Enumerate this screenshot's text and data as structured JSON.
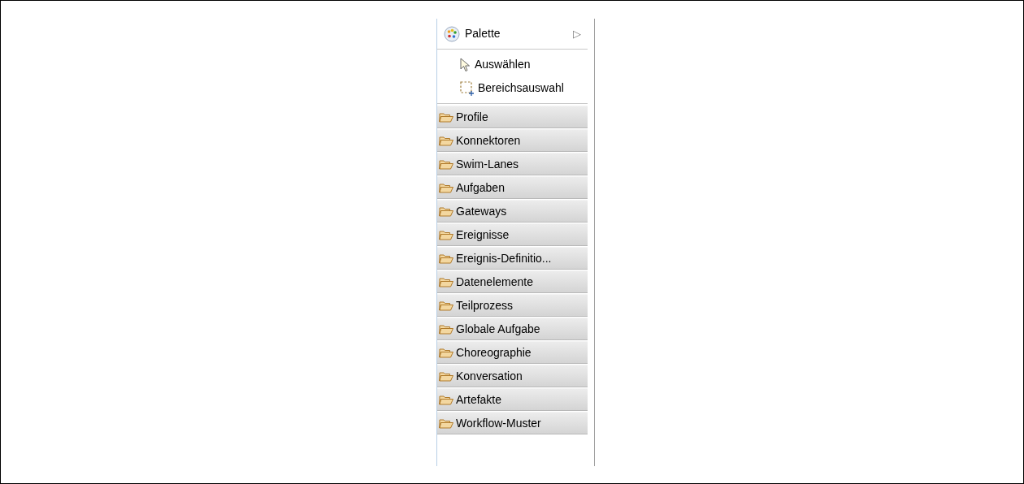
{
  "palette": {
    "title": "Palette",
    "expand_glyph": "▷",
    "tools": [
      {
        "kind": "select",
        "label": "Auswählen"
      },
      {
        "kind": "marquee",
        "label": "Bereichsauswahl"
      }
    ],
    "drawers": [
      {
        "label": "Profile"
      },
      {
        "label": "Konnektoren"
      },
      {
        "label": "Swim-Lanes"
      },
      {
        "label": "Aufgaben"
      },
      {
        "label": "Gateways"
      },
      {
        "label": "Ereignisse"
      },
      {
        "label": "Ereignis-Definitio..."
      },
      {
        "label": "Datenelemente"
      },
      {
        "label": "Teilprozess"
      },
      {
        "label": "Globale Aufgabe"
      },
      {
        "label": "Choreographie"
      },
      {
        "label": "Konversation"
      },
      {
        "label": "Artefakte"
      },
      {
        "label": "Workflow-Muster"
      }
    ]
  }
}
